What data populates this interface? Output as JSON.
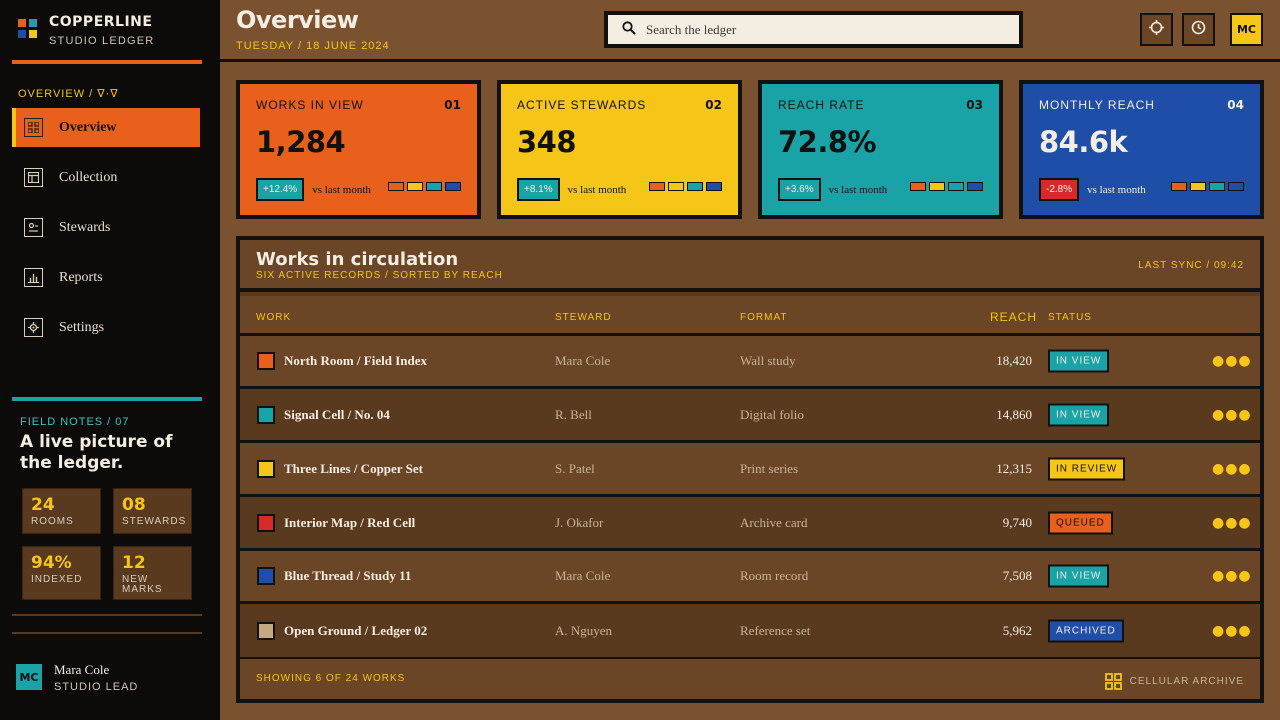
{
  "brand": {
    "title": "COPPERLINE",
    "subtitle": "STUDIO LEDGER"
  },
  "sidebar": {
    "section_label": "OVERVIEW / ∇·∇",
    "items": [
      {
        "label": "Overview",
        "icon": "grid-icon",
        "active": true
      },
      {
        "label": "Collection",
        "icon": "layout-icon",
        "active": false
      },
      {
        "label": "Stewards",
        "icon": "person-card-icon",
        "active": false
      },
      {
        "label": "Reports",
        "icon": "bar-chart-icon",
        "active": false
      },
      {
        "label": "Settings",
        "icon": "gear-icon",
        "active": false
      }
    ],
    "field_notes": {
      "label": "FIELD NOTES / 07",
      "title": "A live picture of the ledger.",
      "stats": [
        {
          "value": "24",
          "label": "ROOMS"
        },
        {
          "value": "08",
          "label": "STEWARDS"
        },
        {
          "value": "94%",
          "label": "INDEXED"
        },
        {
          "value": "12",
          "label": "NEW MARKS"
        }
      ]
    },
    "user": {
      "initials": "MC",
      "name": "Mara Cole",
      "role": "STUDIO LEAD"
    }
  },
  "header": {
    "title": "Overview",
    "date": "TUESDAY / 18 JUNE 2024",
    "search_placeholder": "Search the ledger",
    "avatar_initials": "MC"
  },
  "cards": [
    {
      "label": "WORKS IN VIEW",
      "num": "01",
      "value": "1,284",
      "delta": "+12.4%",
      "vs": "vs last month",
      "bg": "#e8601c"
    },
    {
      "label": "ACTIVE STEWARDS",
      "num": "02",
      "value": "348",
      "delta": "+8.1%",
      "vs": "vs last month",
      "bg": "#f5c518"
    },
    {
      "label": "REACH RATE",
      "num": "03",
      "value": "72.8%",
      "delta": "+3.6%",
      "vs": "vs last month",
      "bg": "#1aa3a6"
    },
    {
      "label": "MONTHLY REACH",
      "num": "04",
      "value": "84.6k",
      "delta": "-2.8%",
      "vs": "vs last month",
      "bg": "#1f4ea8"
    }
  ],
  "table": {
    "title": "Works in circulation",
    "subtitle": "SIX ACTIVE RECORDS / SORTED BY REACH",
    "sync": "LAST SYNC / 09:42",
    "columns": {
      "work": "WORK",
      "steward": "STEWARD",
      "format": "FORMAT",
      "reach": "REACH",
      "status": "STATUS"
    },
    "rows": [
      {
        "color": "#e8601c",
        "work": "North Room / Field Index",
        "steward": "Mara Cole",
        "format": "Wall study",
        "reach": "18,420",
        "status": "IN VIEW"
      },
      {
        "color": "#1aa3a6",
        "work": "Signal Cell / No. 04",
        "steward": "R. Bell",
        "format": "Digital folio",
        "reach": "14,860",
        "status": "IN VIEW"
      },
      {
        "color": "#f5c518",
        "work": "Three Lines / Copper Set",
        "steward": "S. Patel",
        "format": "Print series",
        "reach": "12,315",
        "status": "IN REVIEW"
      },
      {
        "color": "#d42a2a",
        "work": "Interior Map / Red Cell",
        "steward": "J. Okafor",
        "format": "Archive card",
        "reach": "9,740",
        "status": "QUEUED"
      },
      {
        "color": "#1f4ea8",
        "work": "Blue Thread / Study 11",
        "steward": "Mara Cole",
        "format": "Room record",
        "reach": "7,508",
        "status": "IN VIEW"
      },
      {
        "color": "#c4a882",
        "work": "Open Ground / Ledger 02",
        "steward": "A. Nguyen",
        "format": "Reference set",
        "reach": "5,962",
        "status": "ARCHIVED"
      }
    ],
    "footer_left": "SHOWING 6 OF 24 WORKS",
    "footer_right": "CELLULAR ARCHIVE"
  },
  "colors": {
    "orange": "#e8601c",
    "yellow": "#f5c518",
    "teal": "#1aa3a6",
    "blue": "#1f4ea8",
    "red": "#d42a2a"
  }
}
